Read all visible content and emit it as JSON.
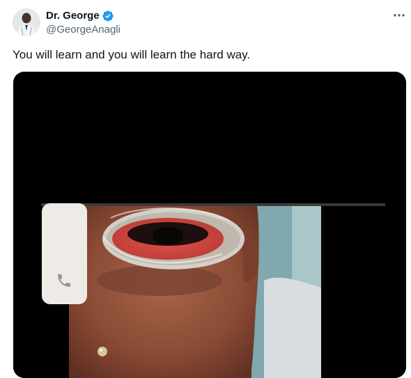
{
  "author": {
    "display_name": "Dr. George",
    "handle": "@GeorgeAnagli",
    "verified_icon": "verified-badge-icon",
    "avatar_icon": "avatar"
  },
  "tweet": {
    "text": "You will learn and you will learn the hard way."
  },
  "menu": {
    "more_icon": "more-options-icon"
  },
  "media": {
    "type": "photo",
    "overlay_icon": "phone-icon"
  },
  "colors": {
    "text_primary": "#0f1419",
    "text_secondary": "#536471",
    "verified_blue": "#1d9bf0",
    "media_background": "#000000"
  }
}
